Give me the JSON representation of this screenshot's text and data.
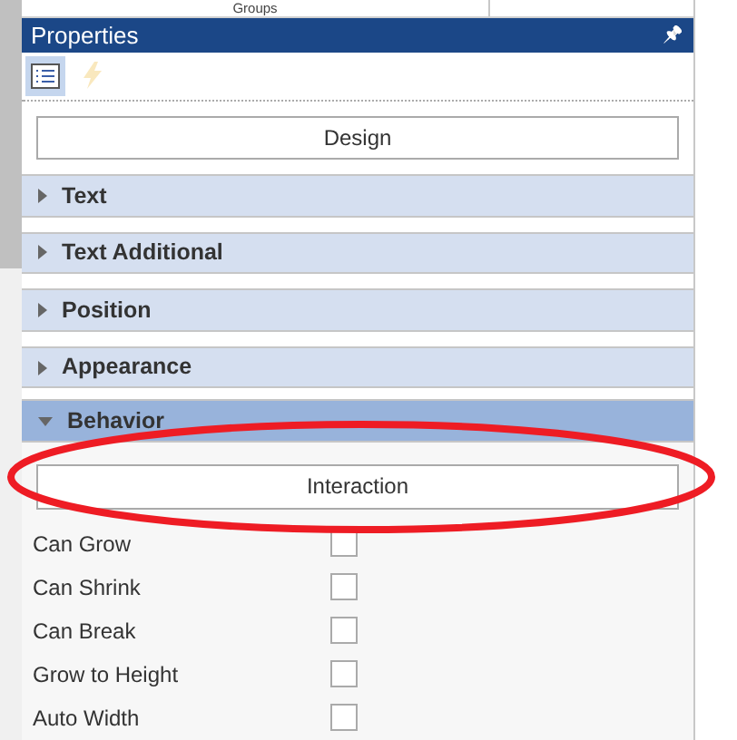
{
  "top_tab": {
    "label": "Groups"
  },
  "panel": {
    "title": "Properties",
    "pin": "📌"
  },
  "toolbar": [
    {
      "kind": "list",
      "selected": true,
      "disabled": false
    },
    {
      "kind": "events",
      "selected": false,
      "disabled": true
    }
  ],
  "design_button": "Design",
  "sections": [
    {
      "label": "Text",
      "expanded": false
    },
    {
      "label": "Text Additional",
      "expanded": false
    },
    {
      "label": "Position",
      "expanded": false
    },
    {
      "label": "Appearance",
      "expanded": false
    },
    {
      "label": "Behavior",
      "expanded": true
    }
  ],
  "behavior": {
    "button": "Interaction",
    "properties": [
      {
        "label": "Can Grow",
        "checked": false
      },
      {
        "label": "Can Shrink",
        "checked": false
      },
      {
        "label": "Can Break",
        "checked": false
      },
      {
        "label": "Grow to Height",
        "checked": false
      },
      {
        "label": "Auto Width",
        "checked": false
      }
    ]
  }
}
